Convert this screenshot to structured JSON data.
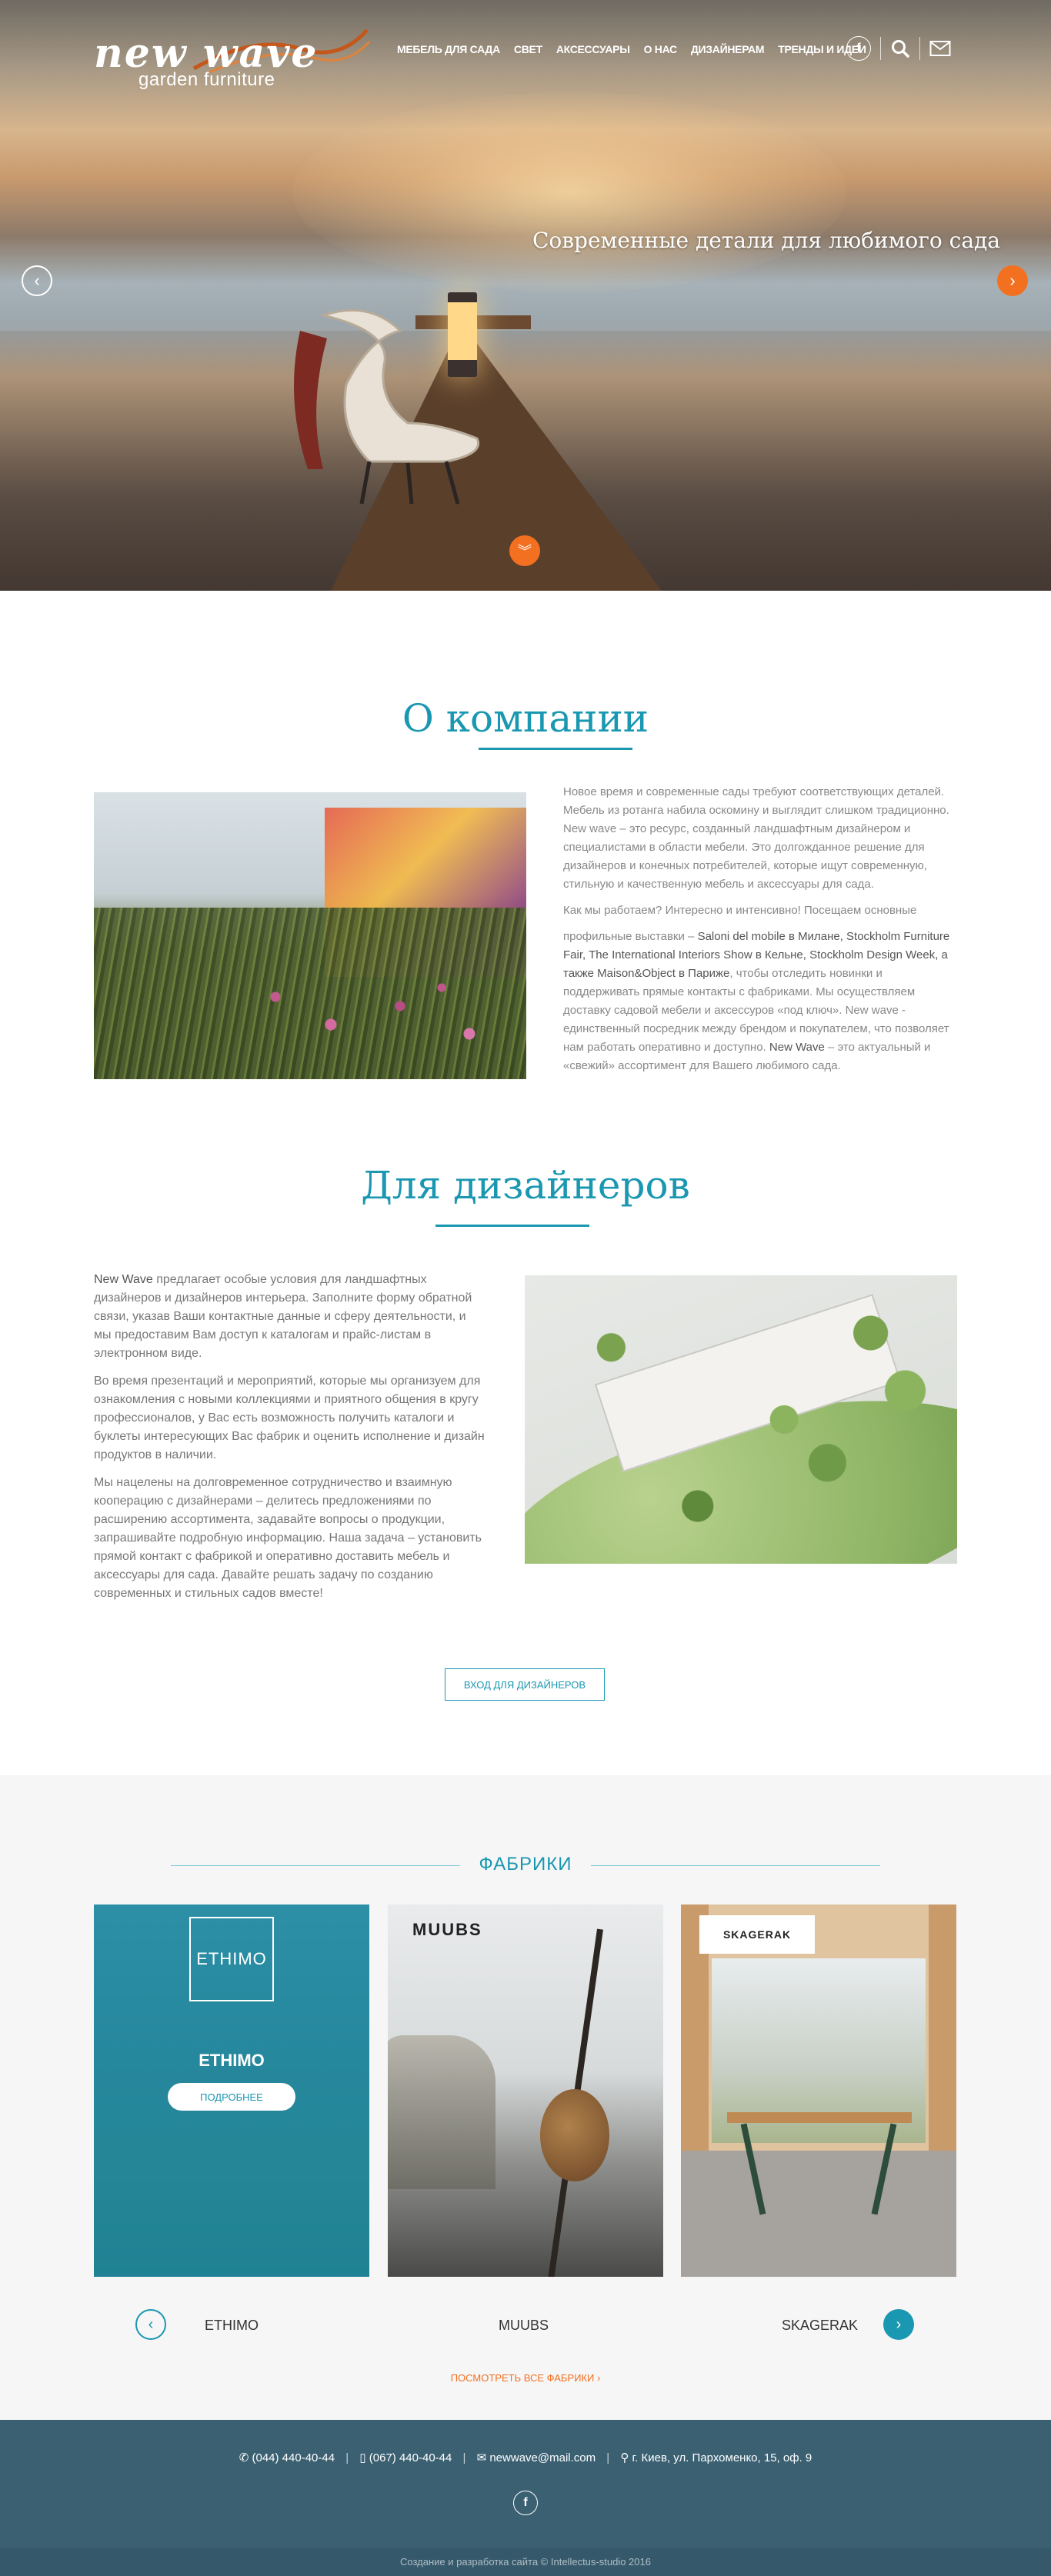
{
  "header": {
    "logo_main": "new wave",
    "logo_sub": "garden furniture",
    "nav": [
      "МЕБЕЛЬ ДЛЯ САДА",
      "СВЕТ",
      "АКСЕССУАРЫ",
      "О НАС",
      "ДИЗАЙНЕРАМ",
      "ТРЕНДЫ И ИДЕИ"
    ],
    "icons": [
      "facebook-icon",
      "search-icon",
      "mail-icon"
    ]
  },
  "hero": {
    "title": "Современные детали для любимого сада",
    "icons": [
      "arrow-left-icon",
      "arrow-right-icon",
      "chevron-down-icon"
    ]
  },
  "about": {
    "title": "О компании",
    "p1": "Новое время и современные сады требуют соответствующих деталей. Мебель из ротанга набила оскомину и выглядит слишком традиционно. New wave – это ресурс, созданный ландшафтным дизайнером и специалистами в области мебели. Это долгожданное решение для дизайнеров и конечных потребителей, которые ищут современную, стильную и качественную мебель и аксессуары для сада.",
    "p2": "Как мы работаем? Интересно и интенсивно! Посещаем основные",
    "p3a": "профильные выставки – ",
    "p3b": "Saloni del mobile в Милане, Stockholm Furniture Fair, The International Interiors Show в Кельне, Stockholm Design Week, а также Maison&Object в Париже",
    "p3c": ", чтобы отследить новинки и поддерживать прямые контакты с фабриками. Мы осуществляем доставку садовой мебели и аксессуров «под ключ». New wave - единственный посредник между брендом и покупателем, что позволяет нам работать оперативно и доступно.",
    "p3d": "New Wave",
    "p3e": " – это актуальный и «свежий» ассортимент для Вашего любимого сада."
  },
  "designers": {
    "title": "Для дизайнеров",
    "p1a": "New Wave",
    "p1b": " предлагает особые условия для ландшафтных дизайнеров и дизайнеров интерьера. Заполните форму обратной связи, указав Ваши контактные данные и сферу деятельности, и мы предоставим Вам доступ к каталогам и прайс-листам в электронном виде.",
    "p2": "Во время презентаций и мероприятий, которые мы организуем для ознакомления с новыми коллекциями и приятного общения в кругу профессионалов, у Вас есть возможность получить каталоги и буклеты интересующих Вас фабрик и оценить исполнение и дизайн продуктов в наличии.",
    "p3": "Мы нацелены на долговременное сотрудничество и взаимную кооперацию с дизайнерами – делитесь предложениями по расширению ассортимента, задавайте вопросы о продукции, запрашивайте подробную информацию. Наша задача – установить прямой контакт с фабрикой и оперативно доставить мебель и аксессуары для сада. Давайте решать задачу по созданию современных и стильных садов вместе!",
    "button": "ВХОД ДЛЯ ДИЗАЙНЕРОВ"
  },
  "factories": {
    "title": "ФАБРИКИ",
    "cards": [
      {
        "logo": "ETHIMO",
        "name": "ETHIMO",
        "button": "ПОДРОБНЕЕ"
      },
      {
        "logo": "MUUBS"
      },
      {
        "logo": "SKAGERAK"
      }
    ],
    "names": [
      "ETHIMO",
      "MUUBS",
      "SKAGERAK"
    ],
    "see_all": "ПОСМОТРЕТЬ ВСЕ ФАБРИКИ ›"
  },
  "footer": {
    "phone1": "(044) 440-40-44",
    "phone2": "(067) 440-40-44",
    "email": "newwave@mail.com",
    "address": "г. Киев, ул. Пархоменко, 15, оф. 9",
    "copyright": "Создание и разработка сайта © Intellectus-studio 2016"
  },
  "colors": {
    "accent": "#1a97b1",
    "orange": "#f37021",
    "footer": "#3a6072"
  }
}
